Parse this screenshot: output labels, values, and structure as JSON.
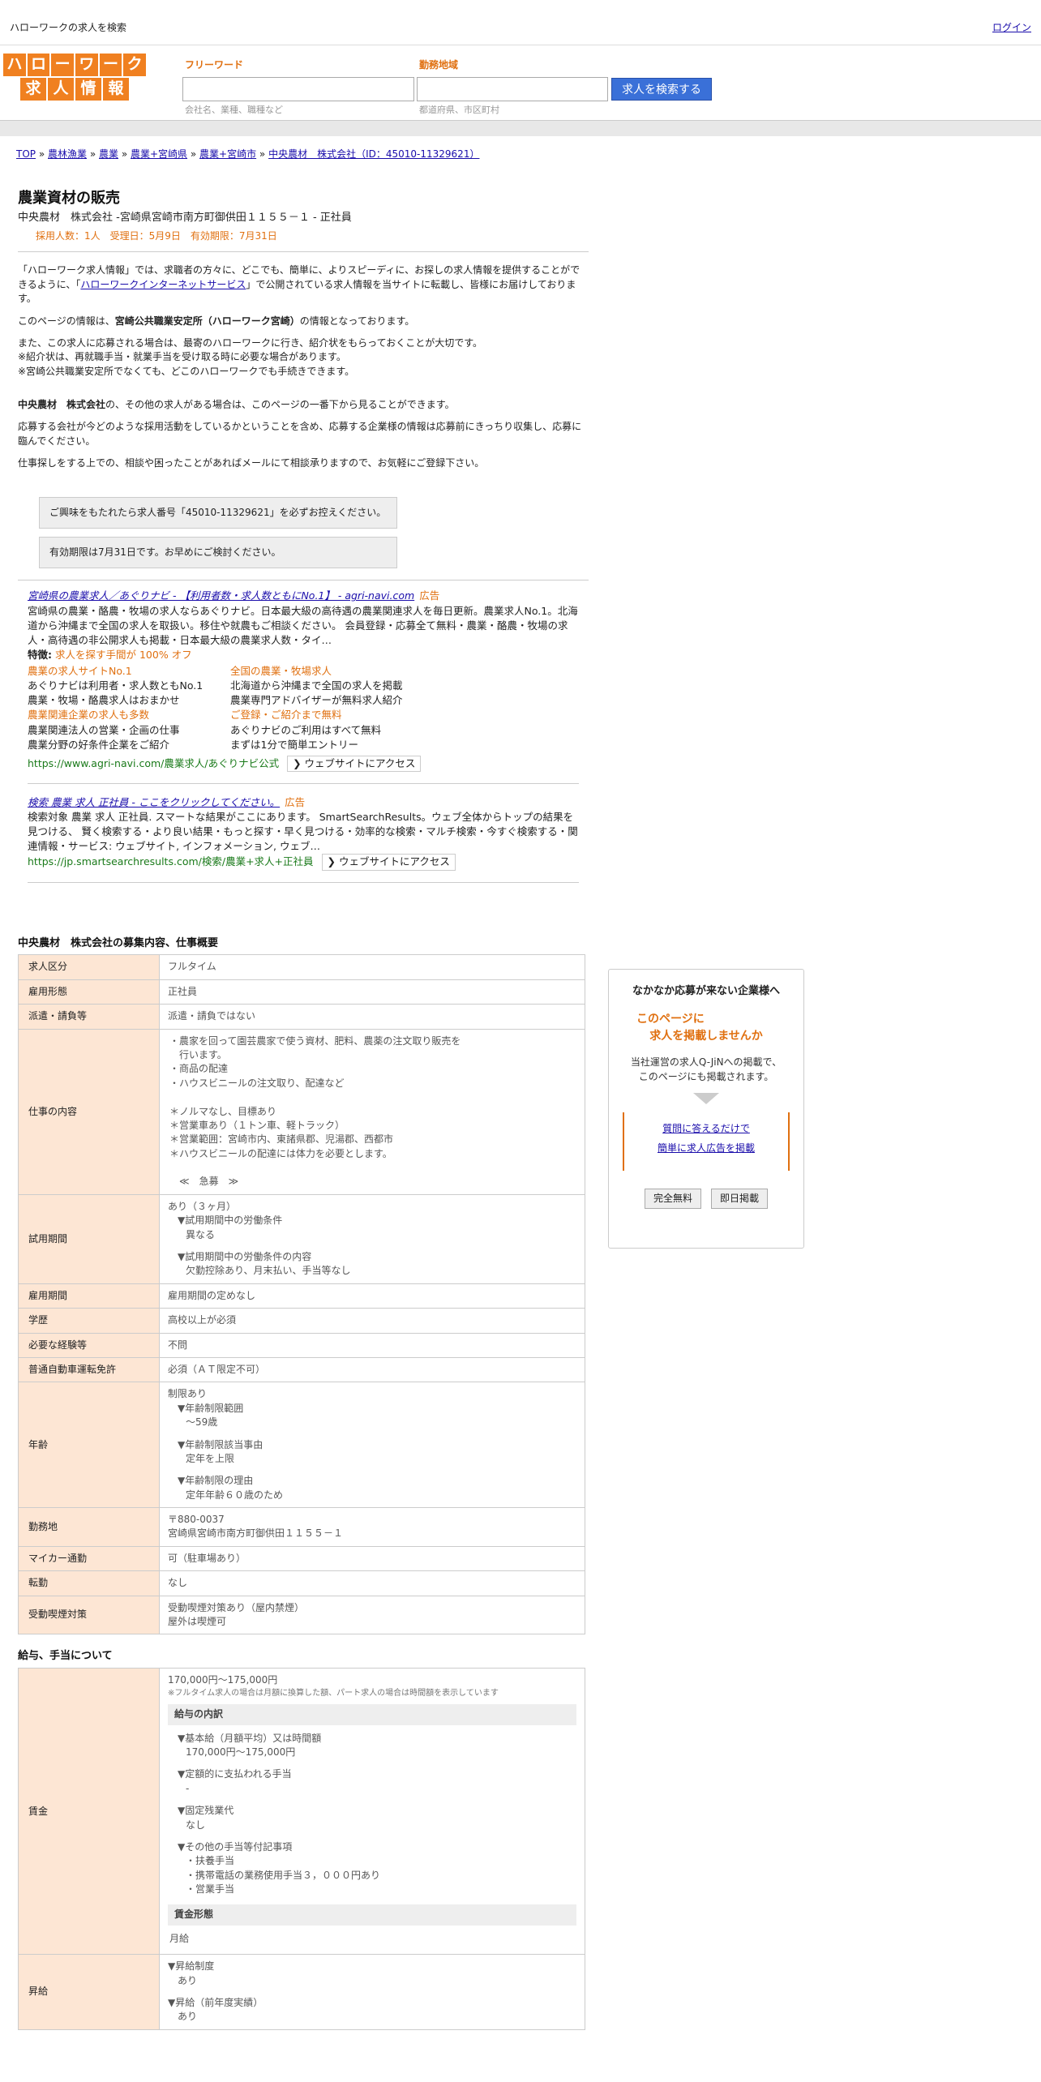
{
  "header": {
    "title": "ハローワークの求人を検索",
    "login": "ログイン"
  },
  "logo": {
    "row1": [
      "ハ",
      "ロ",
      "ー",
      "ワ",
      "ー",
      "ク"
    ],
    "row2": [
      "求",
      "人",
      "情",
      "報"
    ]
  },
  "search": {
    "keyword_label": "フリーワード",
    "keyword_placeholder": "会社名、業種、職種など",
    "area_label": "勤務地域",
    "area_placeholder": "都道府県、市区町村",
    "button": "求人を検索する"
  },
  "breadcrumb": {
    "items": [
      "TOP",
      "農林漁業",
      "農業",
      "農業+宮崎県",
      "農業+宮崎市",
      "中央農材　株式会社（ID：45010-11329621）"
    ],
    "sep": " » "
  },
  "job": {
    "title": "農業資材の販売",
    "company_line": "中央農材　株式会社 -宮崎県宮崎市南方町御供田１１５５－１ - 正社員",
    "meta": "採用人数：1人　受理日：5月9日　有効期限：7月31日"
  },
  "intro": {
    "p1a": "「ハローワーク求人情報」では、求職者の方々に、どこでも、簡単に、よりスピーディに、お探しの求人情報を提供することができるように、「",
    "p1link": "ハローワークインターネットサービス",
    "p1b": "」で公開されている求人情報を当サイトに転載し、皆様にお届けしております。",
    "p2a": "このページの情報は、",
    "p2b": "宮崎公共職業安定所（ハローワーク宮崎）",
    "p2c": "の情報となっております。",
    "p3": "また、この求人に応募される場合は、最寄のハローワークに行き、紹介状をもらっておくことが大切です。",
    "p4": "※紹介状は、再就職手当・就業手当を受け取る時に必要な場合があります。",
    "p5": "※宮崎公共職業安定所でなくても、どこのハローワークでも手続きできます。",
    "p6a": "中央農材　株式会社",
    "p6b": "の、その他の求人がある場合は、このページの一番下から見ることができます。",
    "p7": "応募する会社が今どのような採用活動をしているかということを含め、応募する企業様の情報は応募前にきっちり収集し、応募に臨んでください。",
    "p8": "仕事探しをする上での、相談や困ったことがあればメールにて相談承りますので、お気軽にご登録下さい。"
  },
  "notices": [
    "ご興味をもたれたら求人番号「45010-11329621」を必ずお控えください。",
    "有効期限は7月31日です。お早めにご検討ください。"
  ],
  "ads": [
    {
      "headline": "宮崎県の農業求人／あぐりナビ - 【利用者数・求人数ともにNo.1】 - agri-navi.com",
      "label": "広告",
      "desc": "宮崎県の農業・酪農・牧場の求人ならあぐりナビ。日本最大級の高待遇の農業関連求人を毎日更新。農業求人No.1。北海道から沖縄まで全国の求人を取扱い。移住や就農もご相談ください。 会員登録・応募全て無料・農業・酪農・牧場の求人・高待遇の非公開求人も掲載・日本最大級の農業求人数・タイ…",
      "feature_label": "特徴:",
      "feature": "求人を探す手間が 100% オフ",
      "sitelinks": [
        {
          "t": "農業の求人サイトNo.1",
          "d1": "あぐりナビは利用者・求人数ともNo.1",
          "d2": "農業・牧場・酪農求人はおまかせ"
        },
        {
          "t": "全国の農業・牧場求人",
          "d1": "北海道から沖縄まで全国の求人を掲載",
          "d2": "農業専門アドバイザーが無料求人紹介"
        },
        {
          "t": "農業関連企業の求人も多数",
          "d1": "農業関連法人の営業・企画の仕事",
          "d2": "農業分野の好条件企業をご紹介"
        },
        {
          "t": "ご登録・ご紹介まで無料",
          "d1": "あぐりナビのご利用はすべて無料",
          "d2": "まずは1分で簡単エントリー"
        }
      ],
      "url": "https://www.agri-navi.com/農業求人/あぐりナビ公式",
      "site_btn": "ウェブサイトにアクセス"
    },
    {
      "headline": "検索 農業 求人 正社員 - ここをクリックしてください。",
      "label": "広告",
      "desc": "検索対象 農業 求人 正社員. スマートな結果がここにあります。 SmartSearchResults。ウェブ全体からトップの結果を見つける、 賢く検索する・より良い結果・もっと探す・早く見つける・効率的な検索・マルチ検索・今すぐ検索する・関連情報・サービス: ウェブサイト, インフォメーション, ウェブ…",
      "url": "https://jp.smartsearchresults.com/検索/農業+求人+正社員",
      "site_btn": "ウェブサイトにアクセス"
    }
  ],
  "details": {
    "heading": "中央農材　株式会社の募集内容、仕事概要",
    "rows": [
      {
        "k": "求人区分",
        "v": [
          "フルタイム"
        ]
      },
      {
        "k": "雇用形態",
        "v": [
          "正社員"
        ]
      },
      {
        "k": "派遣・請負等",
        "v": [
          "派遣・請負ではない"
        ]
      }
    ],
    "work": {
      "k": "仕事の内容",
      "lines": [
        "・農家を回って園芸農家で使う資材、肥料、農薬の注文取り販売を",
        "　行います。",
        "・商品の配達",
        "・ハウスビニールの注文取り、配達など",
        "",
        "＊ノルマなし、目標あり",
        "＊営業車あり（１トン車、軽トラック）",
        "＊営業範囲：宮崎市内、東諸県郡、児湯郡、西都市",
        "＊ハウスビニールの配達には体力を必要とします。",
        "",
        "　≪　急募　≫"
      ]
    },
    "trial": {
      "k": "試用期間",
      "v": "あり（３ヶ月）",
      "s1": "▼試用期間中の労働条件",
      "s1v": "異なる",
      "s2": "▼試用期間中の労働条件の内容",
      "s2v": "欠勤控除あり、月末払い、手当等なし"
    },
    "rows2": [
      {
        "k": "雇用期間",
        "v": [
          "雇用期間の定めなし"
        ]
      },
      {
        "k": "学歴",
        "v": [
          "高校以上が必須"
        ]
      },
      {
        "k": "必要な経験等",
        "v": [
          "不問"
        ]
      },
      {
        "k": "普通自動車運転免許",
        "v": [
          "必須（ＡＴ限定不可）"
        ]
      }
    ],
    "age": {
      "k": "年齢",
      "v": "制限あり",
      "s1": "▼年齢制限範囲",
      "s1v": "〜59歳",
      "s2": "▼年齢制限該当事由",
      "s2v": "定年を上限",
      "s3": "▼年齢制限の理由",
      "s3v": "定年年齢６０歳のため"
    },
    "loc": {
      "k": "勤務地",
      "v1": "〒880-0037",
      "v2": "宮崎県宮崎市南方町御供田１１５５－１"
    },
    "rows3": [
      {
        "k": "マイカー通勤",
        "v": [
          "可（駐車場あり）"
        ]
      },
      {
        "k": "転勤",
        "v": [
          "なし"
        ]
      },
      {
        "k": "受動喫煙対策",
        "v": [
          "受動喫煙対策あり（屋内禁煙）",
          "屋外は喫煙可"
        ]
      }
    ]
  },
  "salary": {
    "heading": "給与、手当について",
    "k": "賃金",
    "range": "170,000円〜175,000円",
    "note": "※フルタイム求人の場合は月額に換算した額、パート求人の場合は時間額を表示しています",
    "breakdown": "給与の内訳",
    "b1": "▼基本給（月額平均）又は時間額",
    "b1v": "170,000円〜175,000円",
    "b2": "▼定額的に支払われる手当",
    "b2v": "-",
    "b3": "▼固定残業代",
    "b3v": "なし",
    "b4": "▼その他の手当等付記事項",
    "b4v": [
      "・扶養手当",
      "・携帯電話の業務使用手当３，０００円あり",
      "・営業手当"
    ],
    "form_label": "賃金形態",
    "form": "月給",
    "raise_k": "昇給",
    "r1": "▼昇給制度",
    "r1v": "あり",
    "r2": "▼昇給（前年度実績）",
    "r2v": "あり"
  },
  "sidebar": {
    "t1": "なかなか応募が来ない企業様へ",
    "t2a": "このページに",
    "t2b": "求人を掲載しませんか",
    "t3a": "当社運営の求人Q-JiNへの掲載で、",
    "t3b": "このページにも掲載されます。",
    "link1": "質問に答えるだけで",
    "link2": "簡単に求人広告を掲載",
    "btn1": "完全無料",
    "btn2": "即日掲載"
  }
}
